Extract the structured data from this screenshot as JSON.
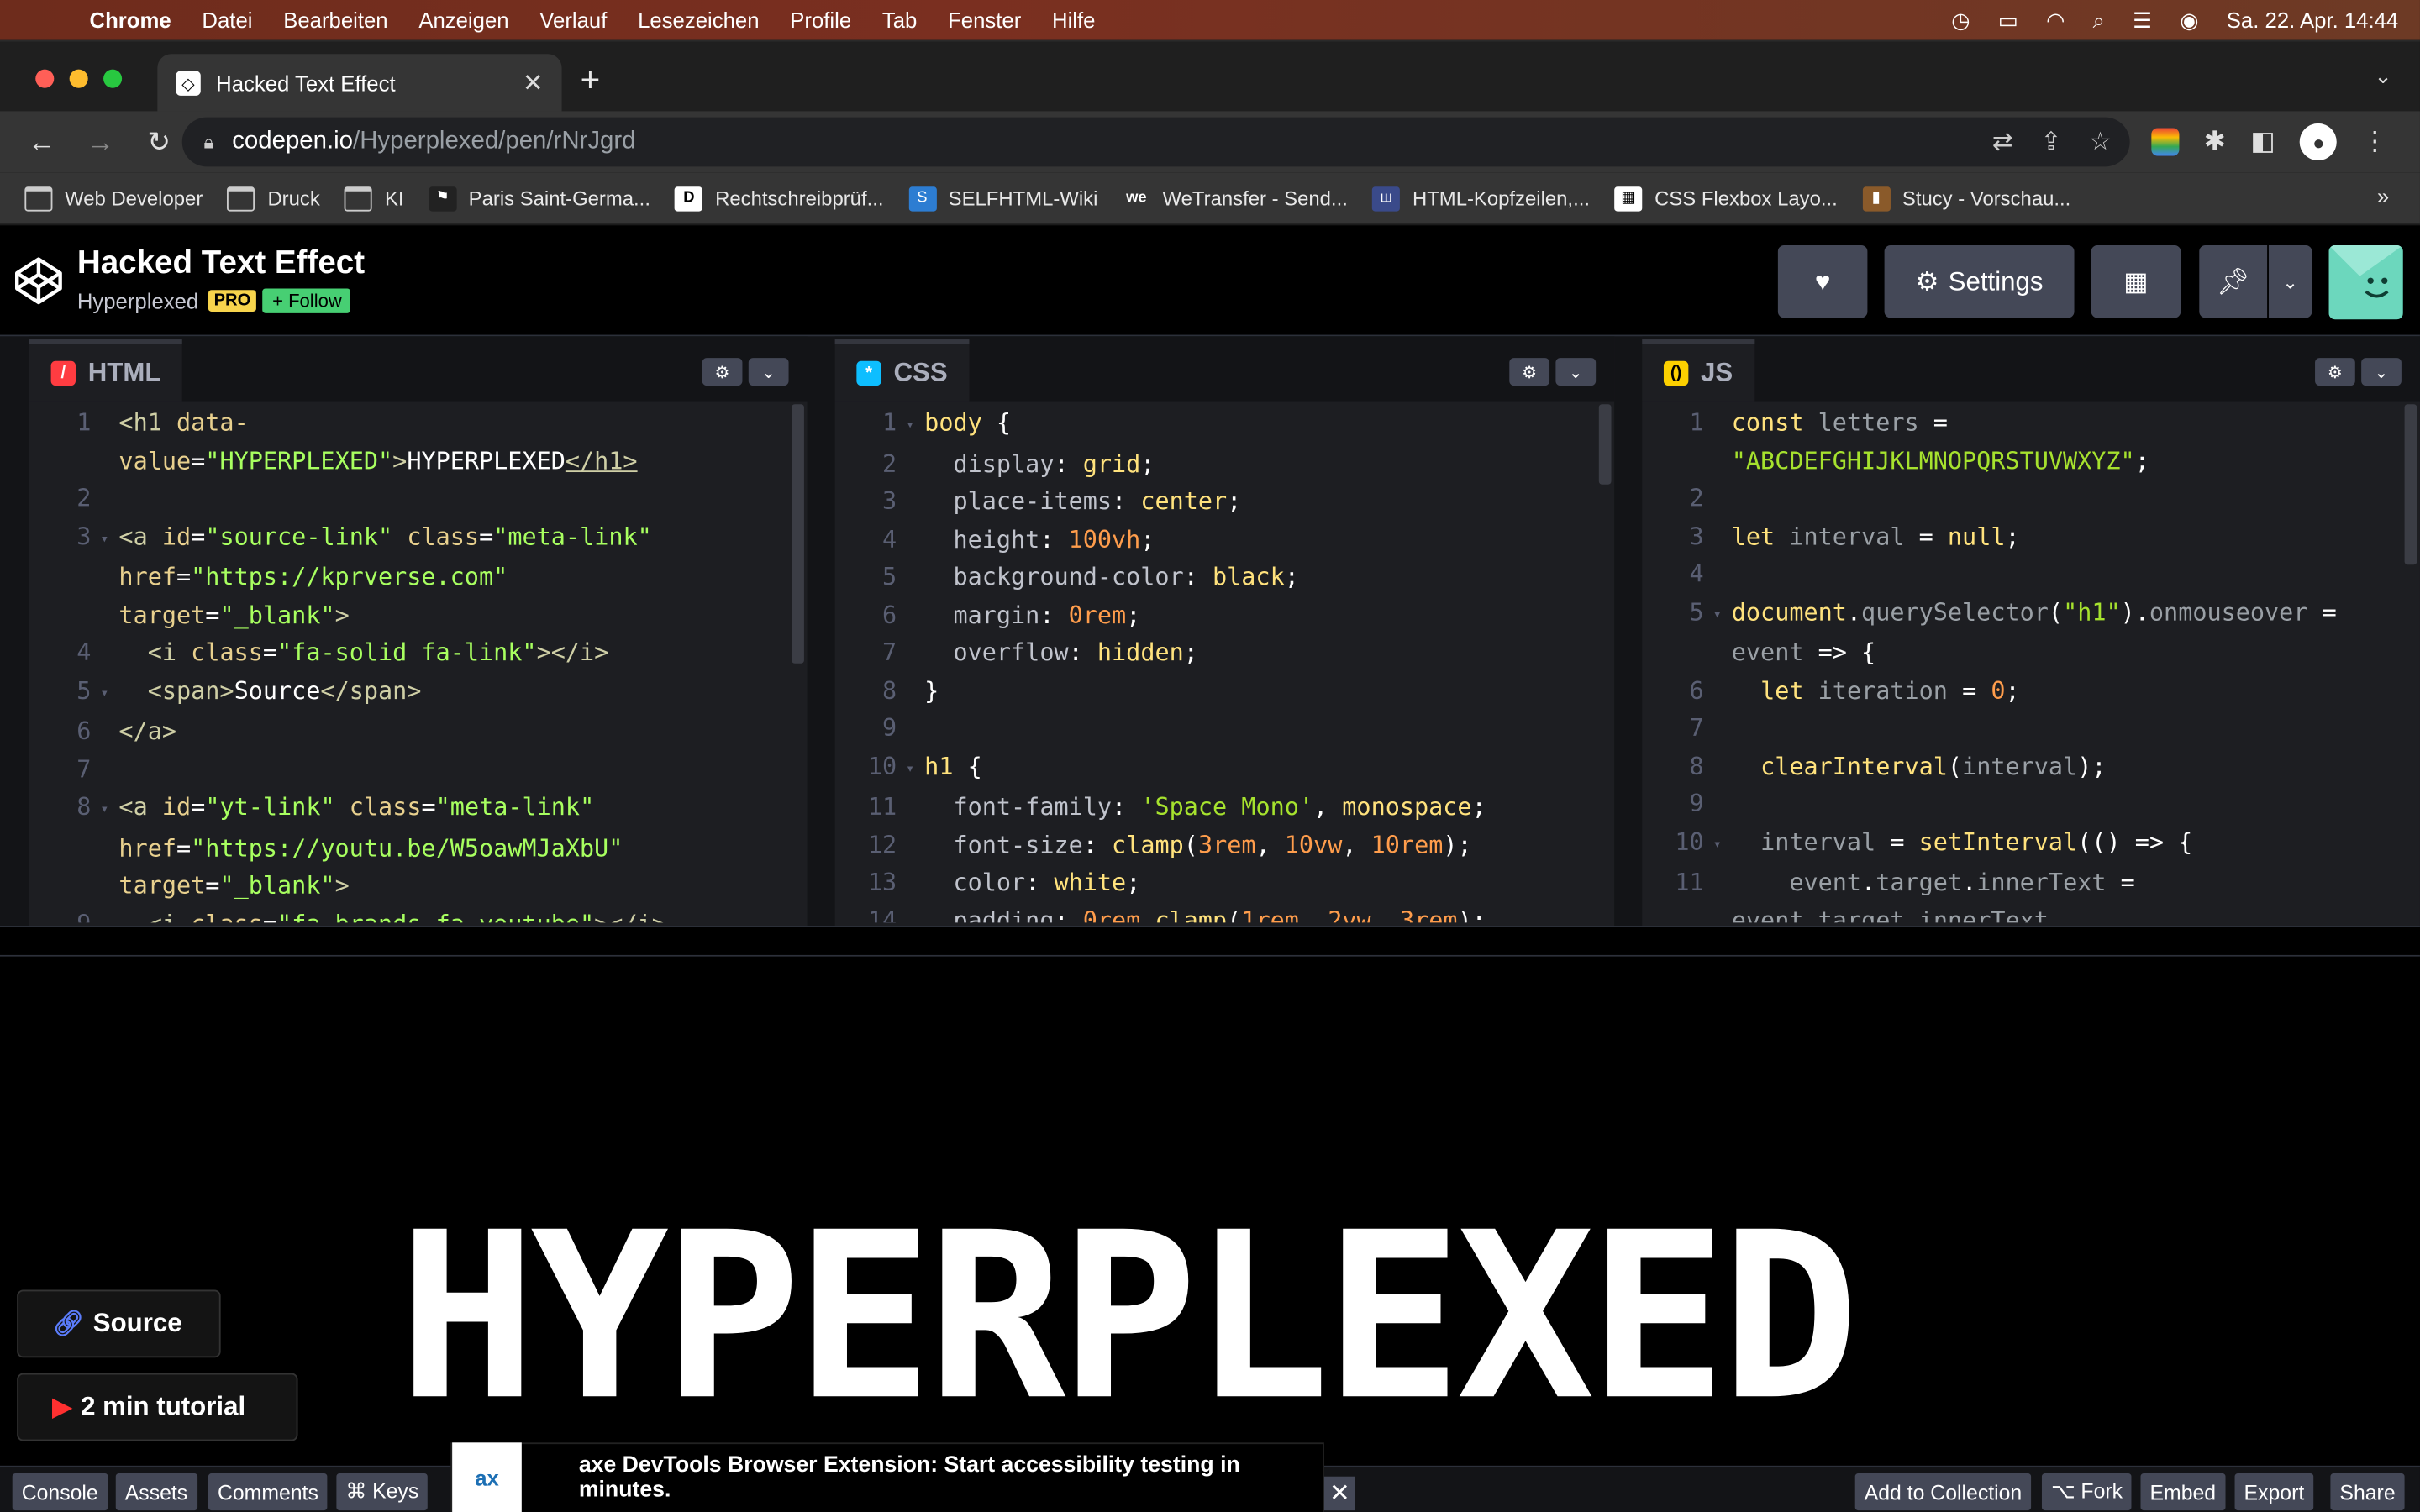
{
  "menubar": {
    "app": "Chrome",
    "items": [
      "Datei",
      "Bearbeiten",
      "Anzeigen",
      "Verlauf",
      "Lesezeichen",
      "Profile",
      "Tab",
      "Fenster",
      "Hilfe"
    ],
    "clock": "Sa. 22. Apr.  14:44"
  },
  "tab": {
    "title": "Hacked Text Effect"
  },
  "omnibox": {
    "host": "codepen.io",
    "path": "/Hyperplexed/pen/rNrJgrd"
  },
  "bookmarks": [
    {
      "label": "Web Developer"
    },
    {
      "label": "Druck"
    },
    {
      "label": "KI"
    },
    {
      "label": "Paris Saint-Germa..."
    },
    {
      "label": "Rechtschreibprüf..."
    },
    {
      "label": "SELFHTML-Wiki"
    },
    {
      "label": "WeTransfer - Send..."
    },
    {
      "label": "HTML-Kopfzeilen,..."
    },
    {
      "label": "CSS Flexbox Layo..."
    },
    {
      "label": "Stucy - Vorschau..."
    }
  ],
  "pen": {
    "title": "Hacked Text Effect",
    "author": "Hyperplexed",
    "pro_badge": "PRO",
    "follow_label": "+ Follow",
    "settings_label": "Settings"
  },
  "panels": {
    "html": {
      "label": "HTML"
    },
    "css": {
      "label": "CSS"
    },
    "js": {
      "label": "JS"
    }
  },
  "preview": {
    "heading": "HYPERPLEXED",
    "source_label": "Source",
    "tutorial_label": "2 min tutorial"
  },
  "footer": {
    "console": "Console",
    "assets": "Assets",
    "comments": "Comments",
    "keys": "⌘ Keys",
    "ad_text": "axe DevTools Browser Extension: Start accessibility testing in minutes.",
    "ad_logo": "ax",
    "add_collection": "Add to Collection",
    "fork": "⌥ Fork",
    "embed": "Embed",
    "export": "Export",
    "share": "Share"
  },
  "colors": {
    "accent_green": "#47cf73",
    "pro_yellow": "#f7d44c",
    "panel_bg": "#1d1e22"
  },
  "icons": [
    "apple-icon",
    "search-icon",
    "wifi-icon",
    "battery-icon",
    "heart-icon",
    "gear-icon",
    "layout-icon",
    "pin-icon",
    "link-icon",
    "youtube-icon"
  ]
}
